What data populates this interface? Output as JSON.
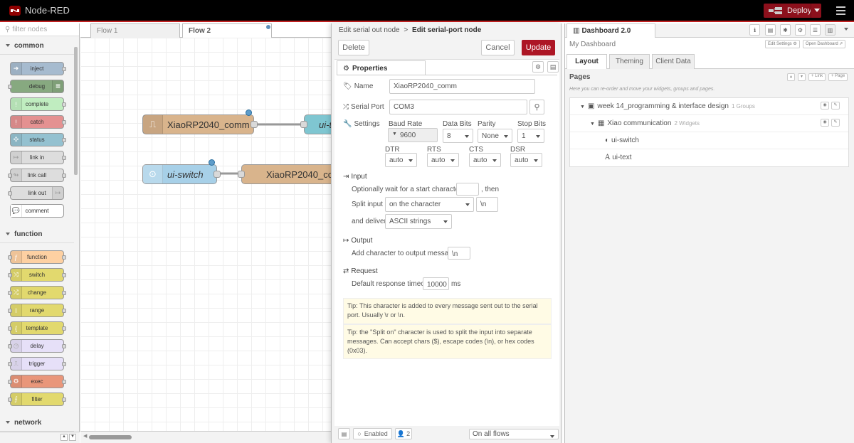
{
  "header": {
    "app_title": "Node-RED",
    "deploy_label": "Deploy"
  },
  "palette": {
    "filter_placeholder": "filter nodes",
    "categories": [
      "common",
      "function",
      "network"
    ],
    "common_nodes": [
      "inject",
      "debug",
      "complete",
      "catch",
      "status",
      "link in",
      "link call",
      "link out",
      "comment"
    ],
    "function_nodes": [
      "function",
      "switch",
      "change",
      "range",
      "template",
      "delay",
      "trigger",
      "exec",
      "filter"
    ]
  },
  "workspace": {
    "tabs": [
      "Flow 1",
      "Flow 2"
    ],
    "nodes": [
      "XiaoRP2040_comm",
      "ui-t",
      "ui-switch",
      "XiaoRP2040_com"
    ]
  },
  "tray": {
    "breadcrumb_parent": "Edit serial out node",
    "breadcrumb_sep": ">",
    "breadcrumb_current": "Edit serial-port node",
    "delete_label": "Delete",
    "cancel_label": "Cancel",
    "update_label": "Update",
    "properties_tab": "Properties",
    "name_label": "Name",
    "name_value": "XiaoRP2040_comm",
    "serial_port_label": "Serial Port",
    "serial_port_value": "COM3",
    "settings_label": "Settings",
    "baud_rate_label": "Baud Rate",
    "baud_rate_value": "9600",
    "data_bits_label": "Data Bits",
    "data_bits_value": "8",
    "parity_label": "Parity",
    "parity_value": "None",
    "stop_bits_label": "Stop Bits",
    "stop_bits_value": "1",
    "dtr_label": "DTR",
    "dtr_value": "auto",
    "rts_label": "RTS",
    "rts_value": "auto",
    "cts_label": "CTS",
    "cts_value": "auto",
    "dsr_label": "DSR",
    "dsr_value": "auto",
    "input_section": "Input",
    "wait_text": "Optionally wait for a start character of",
    "wait_value": "",
    "then_text": ", then",
    "split_label": "Split input",
    "split_value": "on the character",
    "split_char_value": "\\n",
    "deliver_label": "and deliver",
    "deliver_value": "ASCII strings",
    "output_section": "Output",
    "add_char_label": "Add character to output messages",
    "add_char_value": "\\n",
    "request_section": "Request",
    "timeout_label": "Default response timeout",
    "timeout_value": "10000",
    "timeout_unit": "ms",
    "tip1": "Tip: This character is added to every message sent out to the serial port. Usually \\r or \\n.",
    "tip2": "Tip: the \"Split on\" character is used to split the input into separate messages. Can accept chars ($), escape codes (\\n), or hex codes (0x03).",
    "enabled_label": "Enabled",
    "users_count": "2",
    "scope_value": "On all flows"
  },
  "sidebar": {
    "tab_title": "Dashboard 2.0",
    "dashboard_name": "My Dashboard",
    "edit_settings": "Edit Settings",
    "open_dashboard": "Open Dashboard",
    "subtabs": [
      "Layout",
      "Theming",
      "Client Data"
    ],
    "pages_title": "Pages",
    "link_btn": "+ Link",
    "page_btn": "+ Page",
    "note": "Here you can re-order and move your widgets, groups and pages.",
    "page_name": "week 14_programming & interface design",
    "page_meta": "1 Groups",
    "group_name": "Xiao communication",
    "group_meta": "2 Widgets",
    "widgets": [
      "ui-switch",
      "ui-text"
    ]
  }
}
